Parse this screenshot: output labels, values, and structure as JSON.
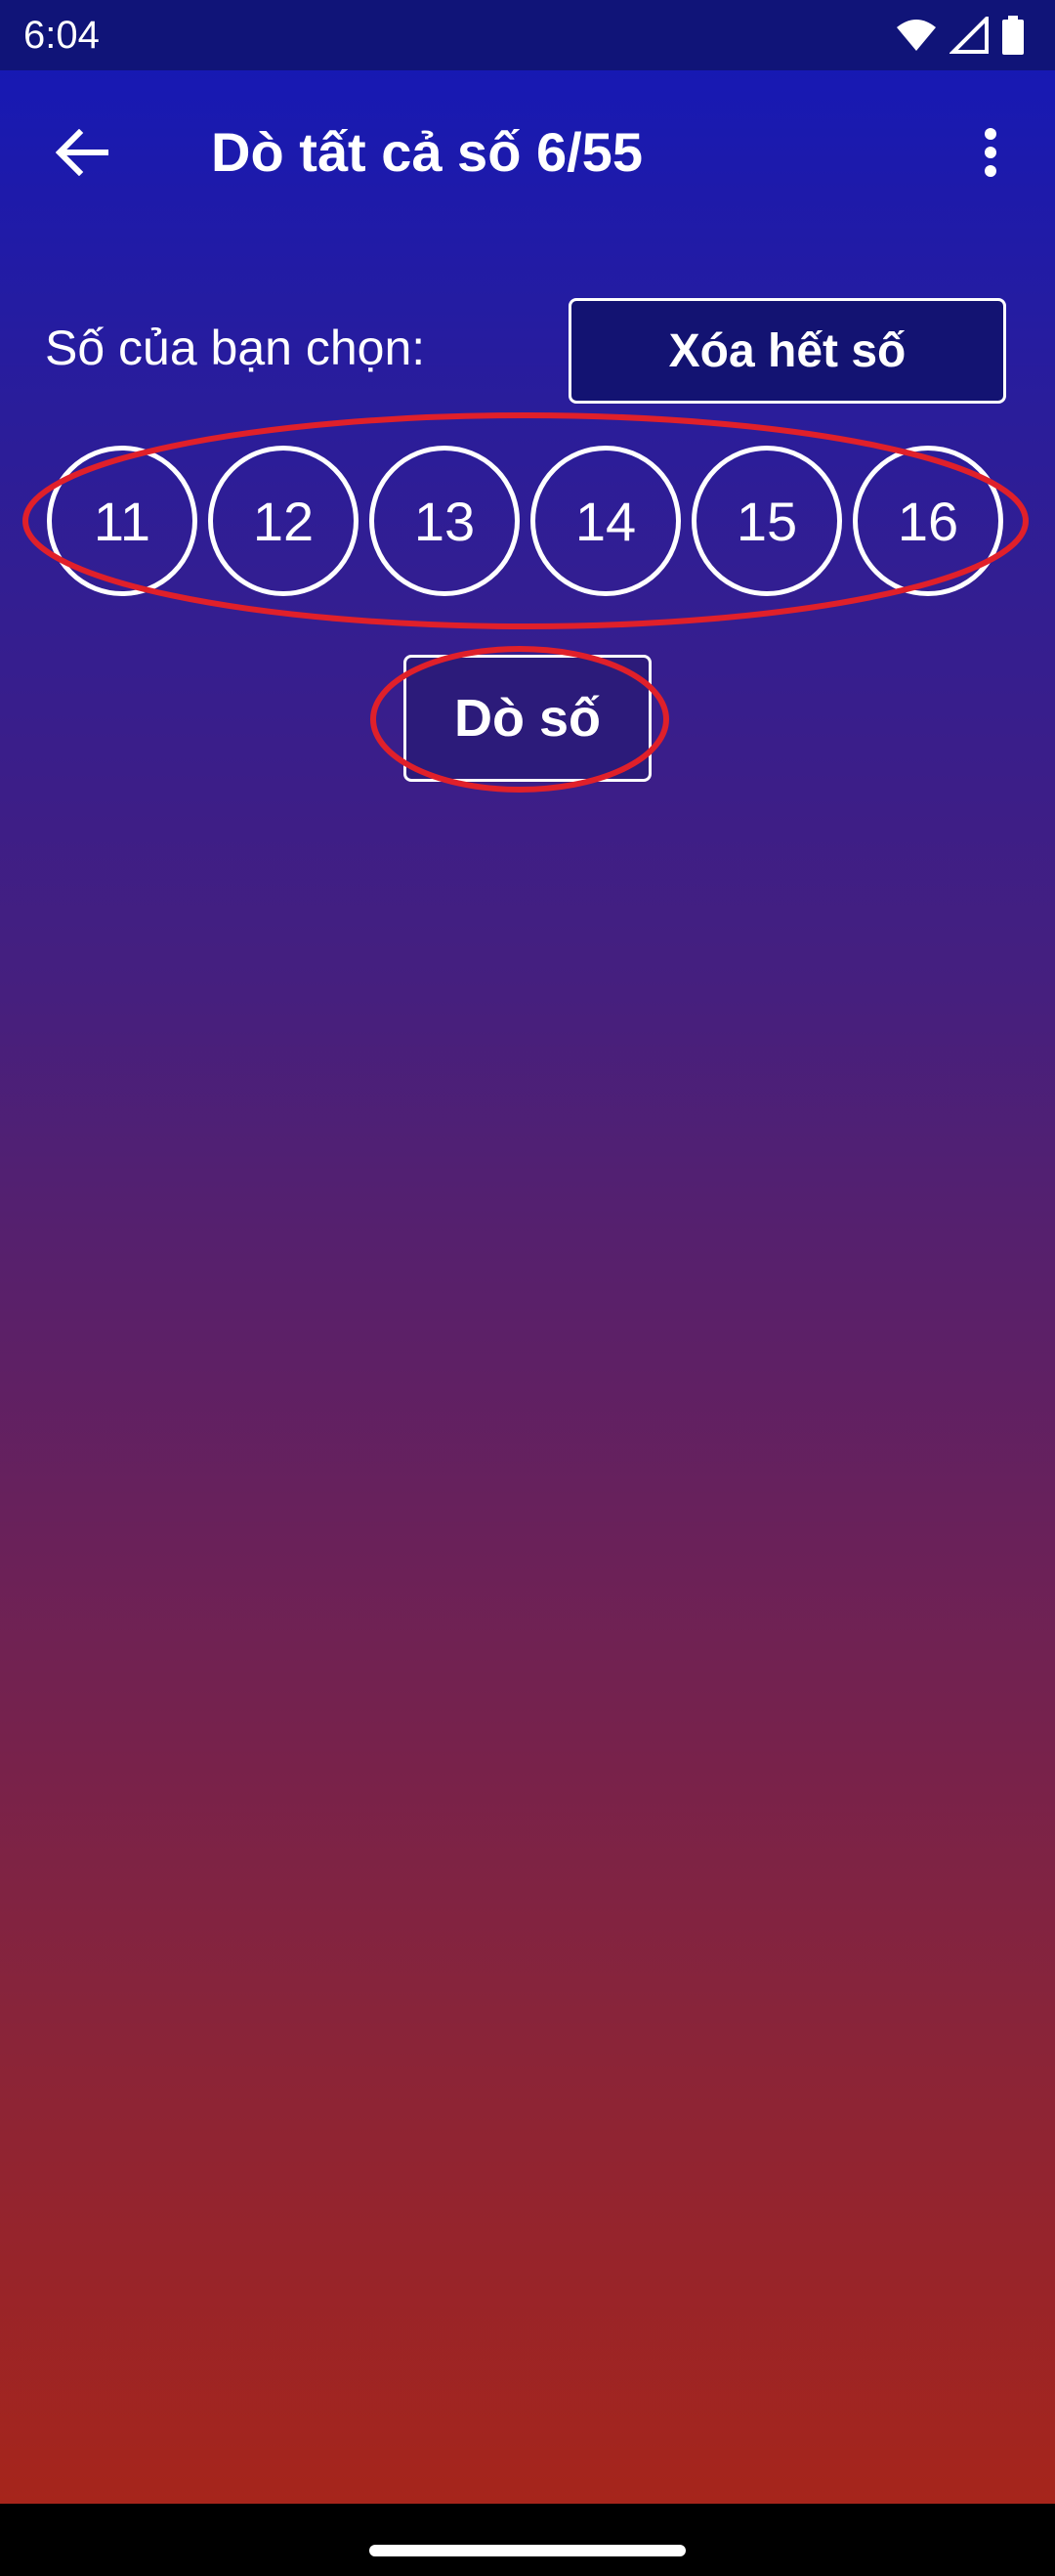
{
  "status_bar": {
    "time": "6:04",
    "icons": [
      "wifi-icon",
      "cell-signal-icon",
      "battery-icon"
    ]
  },
  "app_bar": {
    "title": "Dò tất cả số 6/55",
    "back_icon": "back-arrow-icon",
    "menu_icon": "more-vert-icon"
  },
  "selection": {
    "label": "Số của bạn chọn:",
    "clear_button": "Xóa hết số",
    "numbers": [
      "11",
      "12",
      "13",
      "14",
      "15",
      "16"
    ]
  },
  "check_button": "Dò số",
  "colors": {
    "gradient_top": "#1318b8",
    "gradient_bottom": "#a92518",
    "annotation": "#e0202a",
    "button_bg": "#131372"
  }
}
